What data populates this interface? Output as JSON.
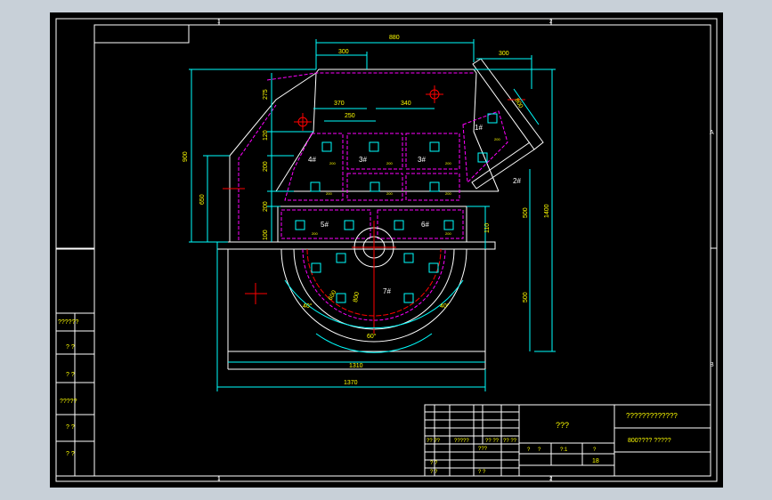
{
  "colors": {
    "viewport_bg": "#c8d0d8",
    "sheet_bg": "#000000",
    "frame": "#ffffff",
    "dimension": "#00ffff",
    "outline": "#ffffff",
    "hidden_line": "#ff00ff",
    "center_line": "#ff0000",
    "label": "#ffff00"
  },
  "frame_marks": {
    "top": [
      "1",
      "2"
    ],
    "bottom": [
      "1",
      "2"
    ],
    "right": [
      "A",
      "B"
    ]
  },
  "dimensions": {
    "top_overall": "880",
    "top_left": "300",
    "top_right": "300",
    "inner_left": "370",
    "inner_right": "340",
    "inner_mid": "250",
    "slope": "800",
    "left_275": "275",
    "left_120": "120",
    "left_200": "200",
    "left_900": "900",
    "left_650": "650",
    "left_200b": "200",
    "left_100": "100",
    "right_1400": "1400",
    "right_500": "500",
    "right_500b": "500",
    "right_110": "110",
    "bottom_1310": "1310",
    "bottom_1370": "1370",
    "angle_60": "60°",
    "angle_40a": "40°",
    "angle_40b": "40°",
    "r1": "600",
    "r2": "800"
  },
  "part_labels": {
    "p1": "1#",
    "p2": "2#",
    "p3a": "3#",
    "p3b": "3#",
    "p4": "4#",
    "p5": "5#",
    "p6": "6#",
    "p7": "7#"
  },
  "small_marks": [
    "200",
    "200",
    "200",
    "200",
    "200",
    "200",
    "200",
    "200",
    "200"
  ],
  "left_stack": {
    "rows": [
      "??????",
      "? ?",
      "? ?",
      "?????",
      "? ?",
      "? ?"
    ]
  },
  "title_block": {
    "drawing_title": "???",
    "company": "?????????????",
    "subtitle": "800???? ?????",
    "sheet_number": "18",
    "row_labels": [
      "?? ??",
      "?????",
      "?? ??",
      "?? ??"
    ],
    "mid_cells": [
      "???",
      "?",
      "?",
      "?:1",
      "?"
    ],
    "left_cells": [
      "? ?",
      "? ?",
      "? ?"
    ]
  }
}
